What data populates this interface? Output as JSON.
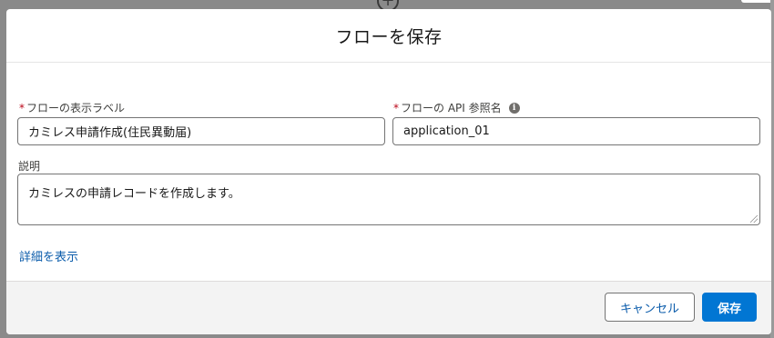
{
  "background": {
    "plus_glyph": "+"
  },
  "modal": {
    "title": "フローを保存",
    "fields": {
      "label": {
        "required_mark": "*",
        "label": "フローの表示ラベル",
        "value": "カミレス申請作成(住民異動届)"
      },
      "api_name": {
        "required_mark": "*",
        "label": "フローの API 参照名",
        "value": "application_01",
        "info_glyph": "i"
      },
      "description": {
        "label": "説明",
        "value": "カミレスの申請レコードを作成します。"
      }
    },
    "show_details_link": "詳細を表示",
    "footer": {
      "cancel_label": "キャンセル",
      "save_label": "保存"
    }
  },
  "colors": {
    "brand": "#0176d3",
    "link": "#0b5cab",
    "required": "#ba0517"
  }
}
